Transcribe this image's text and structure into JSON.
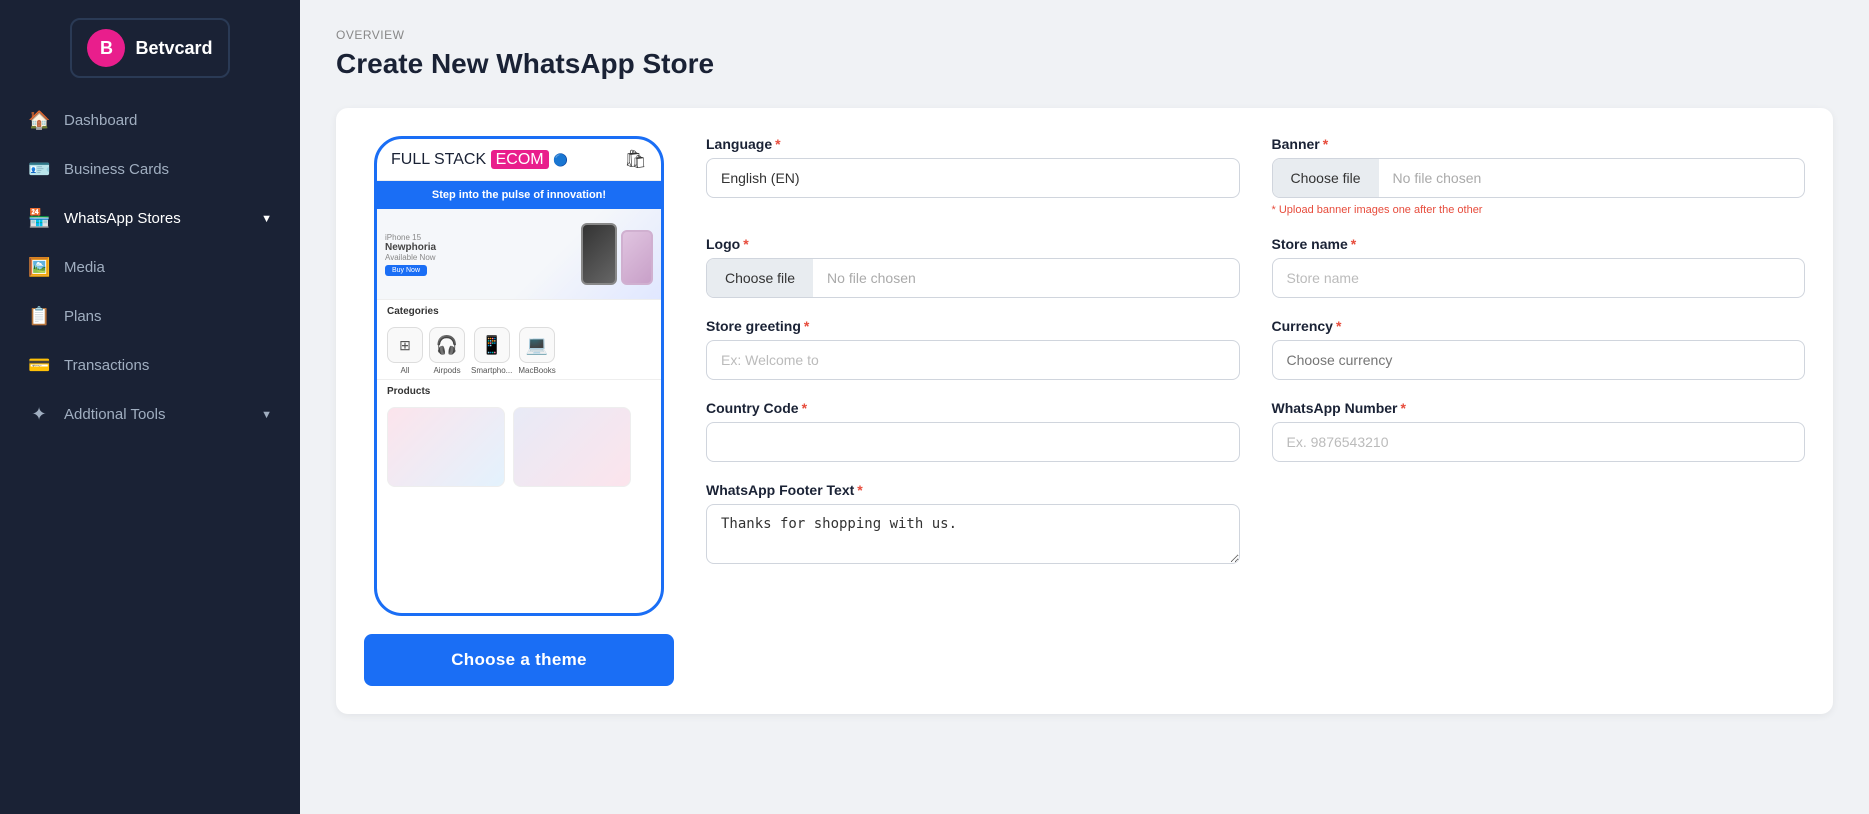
{
  "sidebar": {
    "logo_text": "Betvcard",
    "items": [
      {
        "id": "dashboard",
        "label": "Dashboard",
        "icon": "⊞"
      },
      {
        "id": "business-cards",
        "label": "Business Cards",
        "icon": "⊟"
      },
      {
        "id": "whatsapp-stores",
        "label": "WhatsApp Stores",
        "icon": "☰",
        "has_chevron": true
      },
      {
        "id": "media",
        "label": "Media",
        "icon": "⊡"
      },
      {
        "id": "plans",
        "label": "Plans",
        "icon": "≡"
      },
      {
        "id": "transactions",
        "label": "Transactions",
        "icon": "⊞"
      },
      {
        "id": "additional-tools",
        "label": "Addtional Tools",
        "icon": "✦",
        "has_chevron": true
      }
    ]
  },
  "breadcrumb": "OVERVIEW",
  "page_title": "Create New WhatsApp Store",
  "phone_preview": {
    "logo_full": "FULL STACK",
    "logo_ecom": "ECOM",
    "banner_text": "Step into the pulse of innovation!",
    "product_brand": "iPhone 15",
    "product_name": "Newphoria",
    "product_sub": "Available Now",
    "btn_buy": "Buy Now",
    "categories_label": "Categories",
    "cats": [
      {
        "label": "All",
        "icon": "⊞"
      },
      {
        "label": "Airpods",
        "icon": "🎧"
      },
      {
        "label": "Smartpho...",
        "icon": "📱"
      },
      {
        "label": "MacBooks",
        "icon": "💻"
      }
    ],
    "products_label": "Products"
  },
  "choose_theme_btn": "Choose a theme",
  "form": {
    "language_label": "Language",
    "language_value": "English (EN)",
    "banner_label": "Banner",
    "banner_choose_file": "Choose file",
    "banner_no_file": "No file chosen",
    "banner_hint": "* Upload banner images one after the other",
    "logo_label": "Logo",
    "logo_choose_file": "Choose file",
    "logo_no_file": "No file chosen",
    "store_name_label": "Store name",
    "store_name_placeholder": "Store name",
    "store_greeting_label": "Store greeting",
    "store_greeting_placeholder": "Ex: Welcome to",
    "currency_label": "Currency",
    "currency_placeholder": "Choose currency",
    "country_code_label": "Country Code",
    "country_code_placeholder": "",
    "whatsapp_number_label": "WhatsApp Number",
    "whatsapp_number_placeholder": "Ex. 9876543210",
    "footer_text_label": "WhatsApp Footer Text",
    "footer_text_value": "Thanks for shopping with us."
  }
}
